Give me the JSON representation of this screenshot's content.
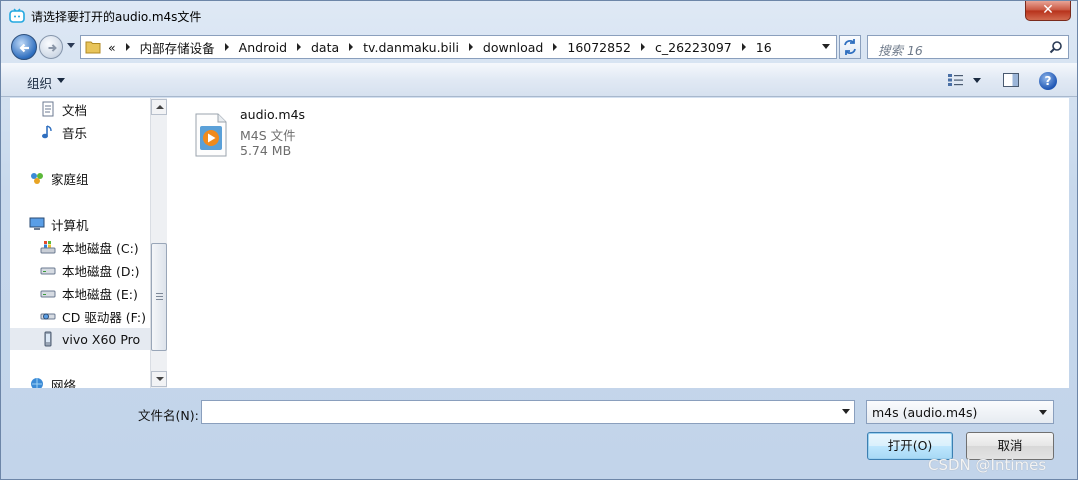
{
  "window": {
    "title": "请选择要打开的audio.m4s文件",
    "close_label": "✕"
  },
  "address": {
    "overflow": "«",
    "crumbs": [
      "内部存储设备",
      "Android",
      "data",
      "tv.danmaku.bili",
      "download",
      "16072852",
      "c_26223097",
      "16"
    ]
  },
  "search": {
    "placeholder": "搜索 16"
  },
  "toolbar": {
    "organize_label": "组织",
    "help_label": "?"
  },
  "nav": {
    "items": [
      {
        "label": "文档",
        "icon": "documents-icon"
      },
      {
        "label": "音乐",
        "icon": "music-icon"
      },
      {
        "label": "家庭组",
        "icon": "homegroup-icon"
      },
      {
        "label": "计算机",
        "icon": "computer-icon"
      },
      {
        "label": "本地磁盘 (C:)",
        "icon": "system-drive-icon"
      },
      {
        "label": "本地磁盘 (D:)",
        "icon": "drive-icon"
      },
      {
        "label": "本地磁盘 (E:)",
        "icon": "drive-icon"
      },
      {
        "label": "CD 驱动器 (F:) 互",
        "icon": "cd-drive-icon"
      },
      {
        "label": "vivo X60 Pro",
        "icon": "phone-icon"
      },
      {
        "label": "网络",
        "icon": "network-icon"
      }
    ]
  },
  "file": {
    "name": "audio.m4s",
    "type": "M4S 文件",
    "size": "5.74 MB",
    "icon": "media-file-icon"
  },
  "bottom": {
    "filename_label": "文件名(N):",
    "filename_value": "",
    "filter_value": "m4s (audio.m4s)",
    "open_label": "打开(O)",
    "cancel_label": "取消"
  },
  "watermark": "CSDN @Intimes",
  "colors": {
    "accent": "#3c7fb1",
    "close": "#c7533d",
    "frame": "#c7d8ec"
  }
}
